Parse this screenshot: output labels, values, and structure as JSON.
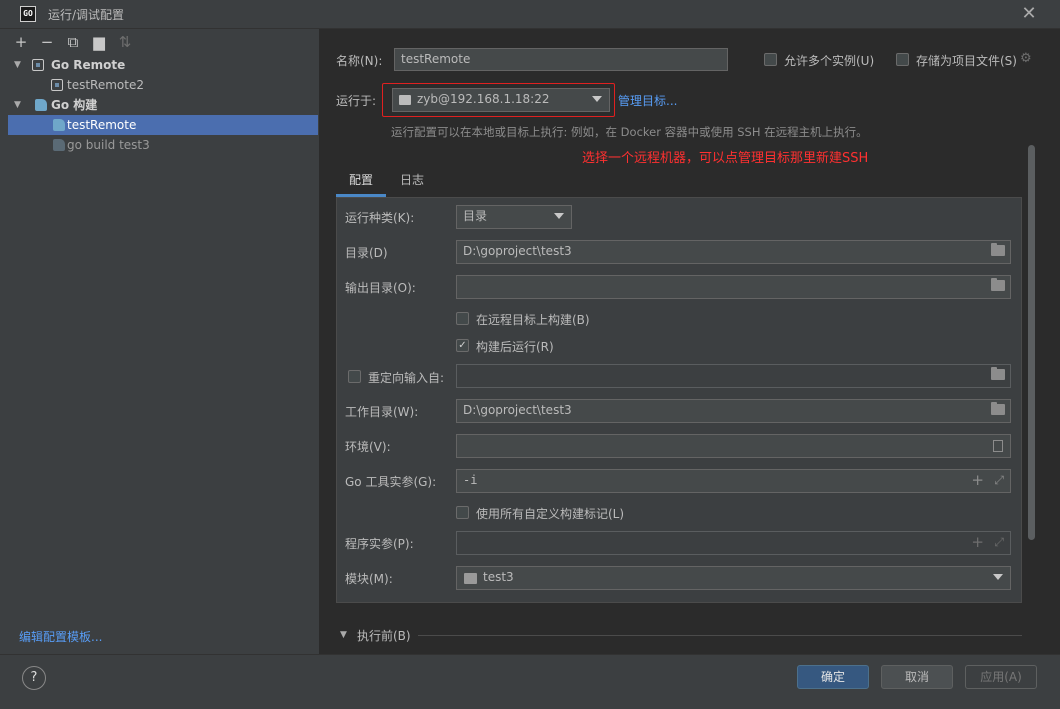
{
  "window": {
    "title": "运行/调试配置",
    "app_icon": "GO"
  },
  "toolbar": {
    "add": "+",
    "remove": "−",
    "copy": "⧉",
    "new_folder": "▆",
    "sort": "⇅"
  },
  "tree": [
    {
      "label": "Go Remote",
      "type": "group"
    },
    {
      "label": "testRemote2",
      "type": "item"
    },
    {
      "label": "Go 构建",
      "type": "group"
    },
    {
      "label": "testRemote",
      "type": "item"
    },
    {
      "label": "go build test3",
      "type": "item"
    }
  ],
  "edit_templates": "编辑配置模板...",
  "form": {
    "name_label": "名称(N):",
    "name_value": "testRemote",
    "allow_multiple": "允许多个实例(U)",
    "store_as_project": "存储为项目文件(S)",
    "run_on_label": "运行于:",
    "run_on_value": "zyb@192.168.1.18:22",
    "manage_targets": "管理目标...",
    "hint": "运行配置可以在本地或目标上执行: 例如，在 Docker 容器中或使用 SSH 在远程主机上执行。",
    "annotation": "选择一个远程机器，可以点管理目标那里新建SSH"
  },
  "tabs": {
    "config": "配置",
    "log": "日志"
  },
  "config": {
    "run_kind_label": "运行种类(K):",
    "run_kind_value": "目录",
    "dir_label": "目录(D)",
    "dir_value": "D:\\goproject\\test3",
    "output_dir_label": "输出目录(O):",
    "output_dir_value": "",
    "build_on_remote": "在远程目标上构建(B)",
    "run_after_build": "构建后运行(R)",
    "redirect_input": "重定向输入自:",
    "redirect_value": "",
    "workdir_label": "工作目录(W):",
    "workdir_value": "D:\\goproject\\test3",
    "env_label": "环境(V):",
    "env_value": "",
    "go_tool_label": "Go 工具实参(G):",
    "go_tool_value": "-i",
    "custom_tags": "使用所有自定义构建标记(L)",
    "program_args_label": "程序实参(P):",
    "program_args_value": "",
    "module_label": "模块(M):",
    "module_value": "test3"
  },
  "before_launch": "执行前(B)",
  "buttons": {
    "ok": "确定",
    "cancel": "取消",
    "apply": "应用(A)",
    "help": "?"
  },
  "colors": {
    "accent": "#4b6eaf",
    "link": "#589df6",
    "annotation": "#ff3030",
    "primary_button": "#365880"
  }
}
